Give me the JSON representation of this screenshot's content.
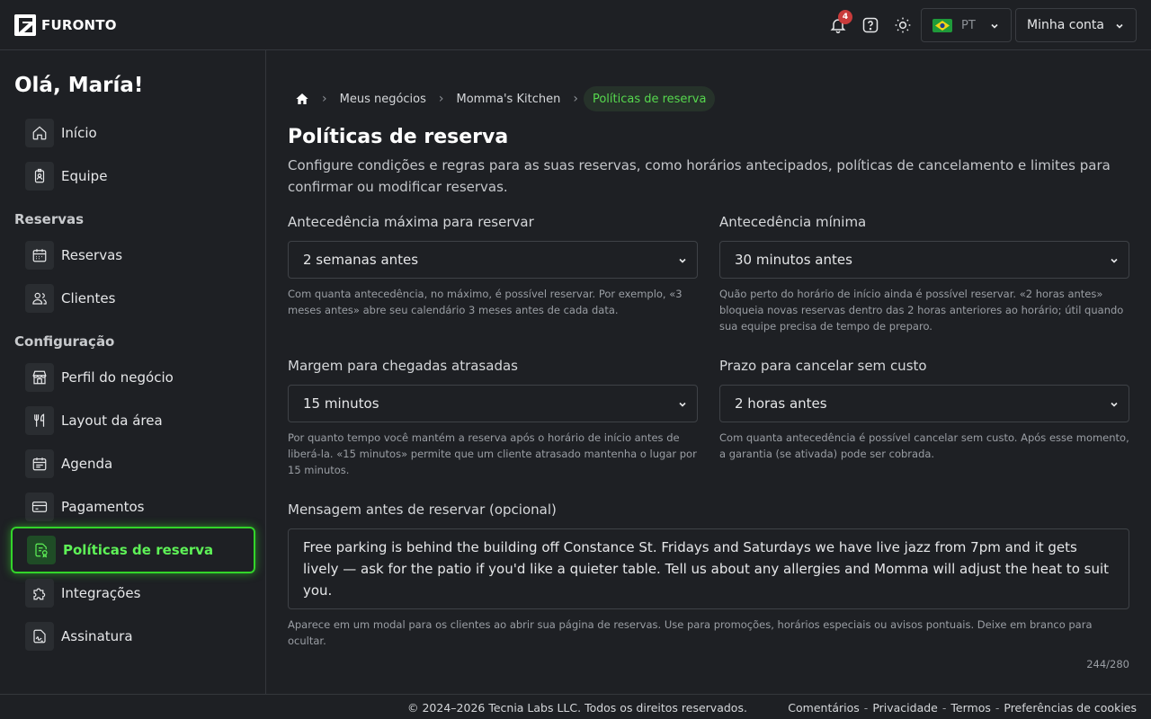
{
  "brand": {
    "name": "FURONTO"
  },
  "header": {
    "notifications_count": "4",
    "language": "PT",
    "account_label": "Minha conta"
  },
  "sidebar": {
    "greeting": "Olá, María!",
    "items_top": [
      {
        "label": "Início",
        "icon": "home-icon"
      },
      {
        "label": "Equipe",
        "icon": "badge-icon"
      }
    ],
    "section_reservas": "Reservas",
    "items_reservas": [
      {
        "label": "Reservas",
        "icon": "calendar-icon"
      },
      {
        "label": "Clientes",
        "icon": "users-icon"
      }
    ],
    "section_config": "Configuração",
    "items_config": [
      {
        "label": "Perfil do negócio",
        "icon": "storefront-icon"
      },
      {
        "label": "Layout da área",
        "icon": "utensils-icon"
      },
      {
        "label": "Agenda",
        "icon": "schedule-icon"
      },
      {
        "label": "Pagamentos",
        "icon": "card-icon"
      },
      {
        "label": "Políticas de reserva",
        "icon": "policy-icon",
        "active": true
      },
      {
        "label": "Integrações",
        "icon": "puzzle-icon"
      },
      {
        "label": "Assinatura",
        "icon": "signature-icon"
      }
    ]
  },
  "breadcrumb": {
    "items": [
      "Meus negócios",
      "Momma's Kitchen"
    ],
    "current": "Políticas de reserva"
  },
  "page": {
    "title": "Políticas de reserva",
    "description": "Configure condições e regras para as suas reservas, como horários antecipados, políticas de cancelamento e limites para confirmar ou modificar reservas."
  },
  "fields": {
    "max_advance": {
      "label": "Antecedência máxima para reservar",
      "value": "2 semanas antes",
      "help": "Com quanta antecedência, no máximo, é possível reservar. Por exemplo, «3 meses antes» abre seu calendário 3 meses antes de cada data."
    },
    "min_advance": {
      "label": "Antecedência mínima",
      "value": "30 minutos antes",
      "help": "Quão perto do horário de início ainda é possível reservar. «2 horas antes» bloqueia novas reservas dentro das 2 horas anteriores ao horário; útil quando sua equipe precisa de tempo de preparo."
    },
    "late_margin": {
      "label": "Margem para chegadas atrasadas",
      "value": "15 minutos",
      "help": "Por quanto tempo você mantém a reserva após o horário de início antes de liberá-la. «15 minutos» permite que um cliente atrasado mantenha o lugar por 15 minutos."
    },
    "cancel_deadline": {
      "label": "Prazo para cancelar sem custo",
      "value": "2 horas antes",
      "help": "Com quanta antecedência é possível cancelar sem custo. Após esse momento, a garantia (se ativada) pode ser cobrada."
    },
    "message": {
      "label": "Mensagem antes de reservar (opcional)",
      "value": "Free parking is behind the building off Constance St. Fridays and Saturdays we have live jazz from 7pm and it gets lively — ask for the patio if you'd like a quieter table. Tell us about any allergies and Momma will adjust the heat to suit you.",
      "help": "Aparece em um modal para os clientes ao abrir sua página de reservas. Use para promoções, horários especiais ou avisos pontuais. Deixe em branco para ocultar.",
      "counter": "244/280"
    }
  },
  "footer": {
    "copyright": "© 2024–2026 Tecnia Labs LLC. Todos os direitos reservados.",
    "links": [
      "Comentários",
      "Privacidade",
      "Termos",
      "Preferências de cookies"
    ],
    "separator": "-"
  },
  "colors": {
    "accent": "#33d42a",
    "background": "#1e2024",
    "badge": "#c93b3b"
  }
}
